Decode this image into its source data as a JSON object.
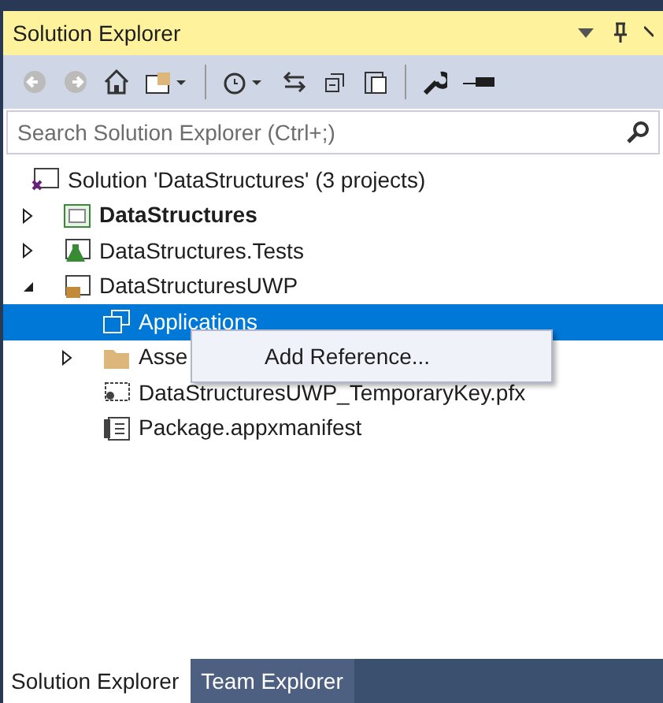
{
  "window": {
    "title": "Solution Explorer"
  },
  "search": {
    "placeholder": "Search Solution Explorer (Ctrl+;)"
  },
  "tree": [
    {
      "label": "Solution 'DataStructures' (3 projects)",
      "kind": "solution",
      "bold": false,
      "selected": false,
      "children": [
        {
          "label": "DataStructures",
          "kind": "csharp",
          "bold": true,
          "selected": false,
          "expanded": false
        },
        {
          "label": "DataStructures.Tests",
          "kind": "test",
          "bold": false,
          "selected": false,
          "expanded": false
        },
        {
          "label": "DataStructuresUWP",
          "kind": "uwp",
          "bold": false,
          "selected": false,
          "expanded": true,
          "children": [
            {
              "label": "Applications",
              "kind": "windows",
              "bold": false,
              "selected": true
            },
            {
              "label": "Asse",
              "kind": "folder",
              "bold": false,
              "selected": false,
              "expanded": false
            },
            {
              "label": "DataStructuresUWP_TemporaryKey.pfx",
              "kind": "cert",
              "bold": false,
              "selected": false
            },
            {
              "label": "Package.appxmanifest",
              "kind": "manifest",
              "bold": false,
              "selected": false
            }
          ]
        }
      ]
    }
  ],
  "context_menu": {
    "items": [
      "Add Reference..."
    ]
  },
  "bottom_tabs": [
    {
      "label": "Solution Explorer",
      "selected": true
    },
    {
      "label": "Team Explorer",
      "selected": false
    }
  ]
}
